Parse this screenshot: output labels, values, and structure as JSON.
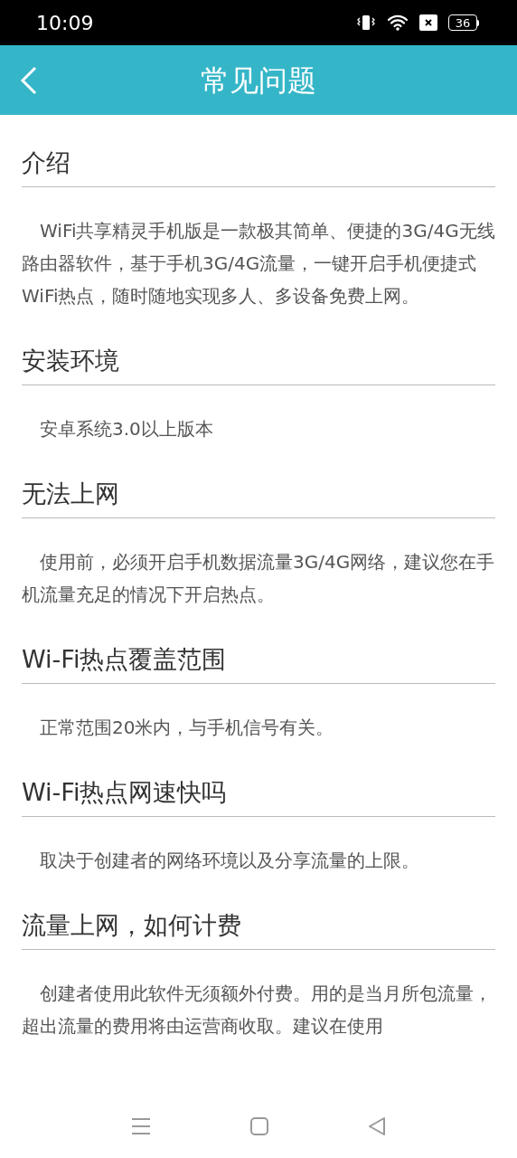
{
  "status_bar": {
    "time": "10:09",
    "battery": "36"
  },
  "header": {
    "title": "常见问题"
  },
  "sections": [
    {
      "heading": "介绍",
      "body": "WiFi共享精灵手机版是一款极其简单、便捷的3G/4G无线路由器软件，基于手机3G/4G流量，一键开启手机便捷式WiFi热点，随时随地实现多人、多设备免费上网。"
    },
    {
      "heading": "安装环境",
      "body": "安卓系统3.0以上版本"
    },
    {
      "heading": "无法上网",
      "body": "使用前，必须开启手机数据流量3G/4G网络，建议您在手机流量充足的情况下开启热点。"
    },
    {
      "heading": "Wi-Fi热点覆盖范围",
      "body": "正常范围20米内，与手机信号有关。"
    },
    {
      "heading": "Wi-Fi热点网速快吗",
      "body": "取决于创建者的网络环境以及分享流量的上限。"
    },
    {
      "heading": "流量上网，如何计费",
      "body": "创建者使用此软件无须额外付费。用的是当月所包流量，超出流量的费用将由运营商收取。建议在使用"
    }
  ]
}
